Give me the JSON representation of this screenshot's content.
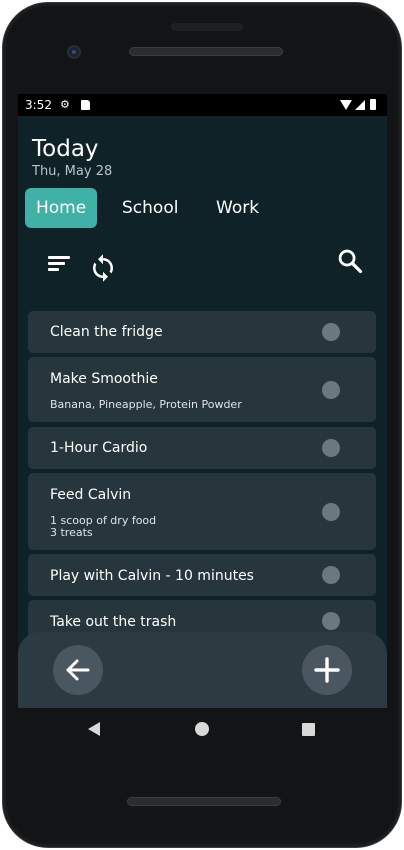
{
  "status_bar": {
    "time": "3:52"
  },
  "header": {
    "title": "Today",
    "date": "Thu, May 28"
  },
  "tabs": [
    {
      "label": "Home",
      "active": true
    },
    {
      "label": "School",
      "active": false
    },
    {
      "label": "Work",
      "active": false
    }
  ],
  "toolbar": {
    "sort_icon": "sort-icon",
    "sync_icon": "sync-icon",
    "search_icon": "search-icon"
  },
  "tasks": [
    {
      "title": "Clean the fridge",
      "subtitle_lines": []
    },
    {
      "title": "Make Smoothie",
      "subtitle_lines": [
        "Banana, Pineapple, Protein Powder"
      ]
    },
    {
      "title": "1-Hour Cardio",
      "subtitle_lines": []
    },
    {
      "title": "Feed Calvin",
      "subtitle_lines": [
        "1 scoop of dry food",
        "3 treats"
      ]
    },
    {
      "title": "Play with Calvin - 10 minutes",
      "subtitle_lines": []
    },
    {
      "title": "Take out the trash",
      "subtitle_lines": []
    }
  ],
  "bottom_bar": {
    "back_icon": "arrow-left-icon",
    "add_icon": "plus-icon"
  },
  "colors": {
    "background": "#0e2228",
    "accent": "#3fb1a6",
    "task_card": "#27363d",
    "fab": "#4a5660",
    "check": "#6c7881"
  }
}
